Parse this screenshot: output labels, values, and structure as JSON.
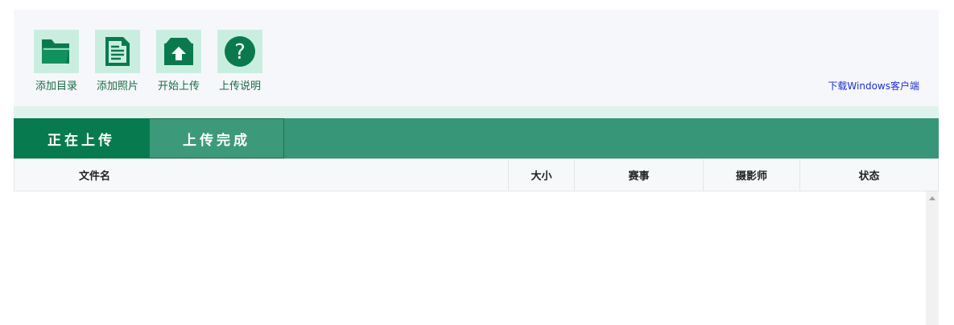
{
  "toolbar": {
    "items": [
      {
        "label": "添加目录",
        "icon": "folder-open-icon"
      },
      {
        "label": "添加照片",
        "icon": "document-icon"
      },
      {
        "label": "开始上传",
        "icon": "upload-icon"
      },
      {
        "label": "上传说明",
        "icon": "help-icon"
      }
    ],
    "download_link": "下载Windows客户端"
  },
  "tabs": [
    {
      "label": "正在上传",
      "active": true
    },
    {
      "label": "上传完成",
      "active": false
    }
  ],
  "table": {
    "columns": [
      "文件名",
      "大小",
      "赛事",
      "摄影师",
      "状态"
    ],
    "rows": []
  },
  "colors": {
    "accent": "#077a4f",
    "tab_bar": "#389678",
    "icon_tile": "#c9eee0",
    "link": "#1d2fd0"
  }
}
